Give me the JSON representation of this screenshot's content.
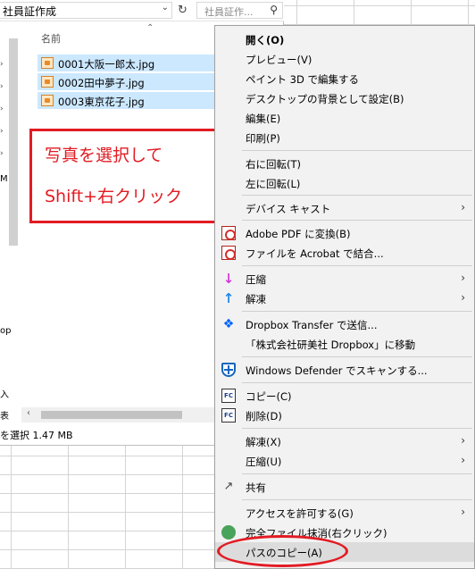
{
  "explorer": {
    "address": "社員証作成",
    "search_placeholder": "社員証作...",
    "column_name": "名前",
    "files": [
      "0001大阪一郎太.jpg",
      "0002田中夢子.jpg",
      "0003東京花子.jpg"
    ],
    "status": "を選択  1.47 MB",
    "nav_fragments": [
      "M",
      "op",
      "入",
      "表"
    ]
  },
  "annotation": {
    "line1": "写真を選択して",
    "line2": "Shift+右クリック"
  },
  "context_menu": {
    "items": [
      {
        "label": "開く(O)",
        "bold": true
      },
      {
        "label": "プレビュー(V)"
      },
      {
        "label": "ペイント 3D で編集する"
      },
      {
        "label": "デスクトップの背景として設定(B)"
      },
      {
        "label": "編集(E)"
      },
      {
        "label": "印刷(P)"
      },
      {
        "label": "右に回転(T)"
      },
      {
        "label": "左に回転(L)"
      },
      {
        "label": "デバイス キャスト",
        "submenu": true
      },
      {
        "label": "Adobe PDF に変換(B)",
        "icon": "pdf-icon"
      },
      {
        "label": "ファイルを Acrobat で結合...",
        "icon": "acrobat-icon"
      },
      {
        "label": "圧縮",
        "icon": "compress-arrow-icon",
        "submenu": true
      },
      {
        "label": "解凍",
        "icon": "extract-arrow-icon",
        "submenu": true
      },
      {
        "label": "Dropbox Transfer で送信...",
        "icon": "dropbox-icon"
      },
      {
        "label": "「株式会社研美社 Dropbox」に移動"
      },
      {
        "label": "Windows Defender でスキャンする...",
        "icon": "defender-icon"
      },
      {
        "label": "コピー(C)",
        "icon": "fc-copy-icon"
      },
      {
        "label": "削除(D)",
        "icon": "fc-delete-icon"
      },
      {
        "label": "解凍(X)",
        "submenu": true
      },
      {
        "label": "圧縮(U)",
        "submenu": true
      },
      {
        "label": "共有",
        "icon": "share-icon"
      },
      {
        "label": "アクセスを許可する(G)",
        "submenu": true
      },
      {
        "label": "完全ファイル抹消(右クリック)",
        "icon": "shredder-icon"
      },
      {
        "label": "パスのコピー(A)",
        "highlight": true
      }
    ]
  },
  "colors": {
    "annotation_red": "#e21b23",
    "selection_blue": "#cce8ff",
    "menu_bg": "#f2f2f2"
  }
}
